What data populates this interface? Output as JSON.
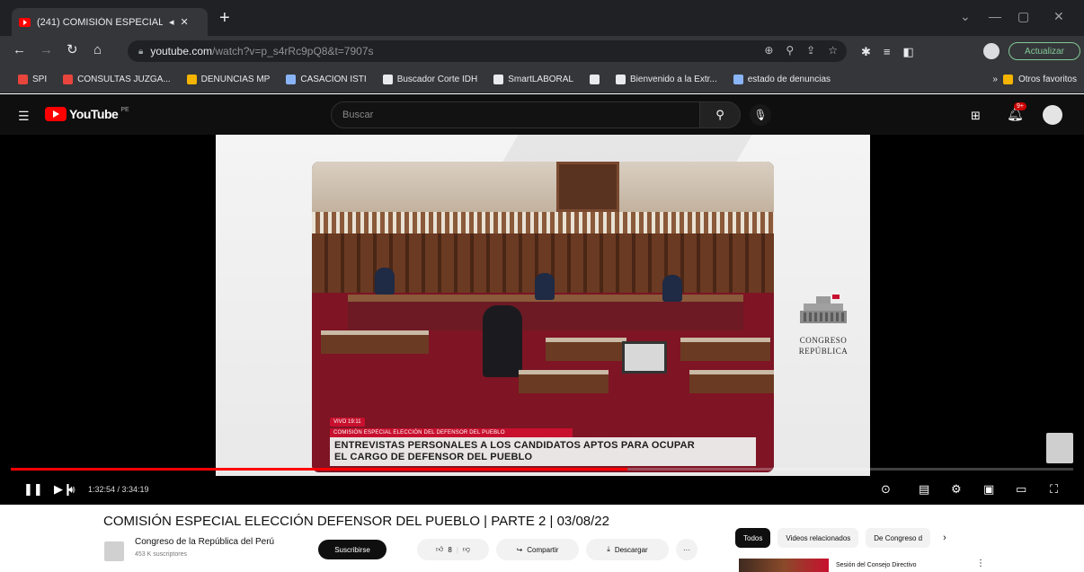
{
  "browser": {
    "tab": {
      "title": "(241) COMISIÓN ESPECIAL E",
      "pin_icon": "pin-icon",
      "close": "✕"
    },
    "new_tab": "+",
    "url": {
      "host": "youtube.com",
      "path": "/watch?v=p_s4rRc9pQ8&t=7907s"
    },
    "update_button": "Actualizar",
    "bookmarks": [
      {
        "label": "SPI",
        "color": "#e8453c"
      },
      {
        "label": "CONSULTAS JUZGA...",
        "color": "#e8453c"
      },
      {
        "label": "DENUNCIAS MP",
        "color": "#f4b400"
      },
      {
        "label": "CASACION ISTI",
        "color": "#8ab4f8"
      },
      {
        "label": "Buscador Corte IDH",
        "color": "#e8eaed"
      },
      {
        "label": "SmartLABORAL",
        "color": "#e8eaed"
      },
      {
        "label": "",
        "color": "#e8eaed"
      },
      {
        "label": "Bienvenido a la Extr...",
        "color": "#e8eaed"
      },
      {
        "label": "estado de denuncias",
        "color": "#8ab4f8"
      }
    ],
    "other_bookmarks": "Otros favoritos"
  },
  "youtube": {
    "logo_text": "YouTube",
    "logo_cc": "PE",
    "search_placeholder": "Buscar",
    "notifications_badge": "9+"
  },
  "player": {
    "progress_fraction": 0.58,
    "time_current": "1:32:54",
    "time_total": "3:34:19",
    "time_display": "1:32:54 / 3:34:19",
    "overlay": {
      "tag": "VIVO 19:11",
      "subtitle": "COMISIÓN ESPECIAL ELECCIÓN DEL DEFENSOR DEL PUEBLO",
      "headline_line1": "ENTREVISTAS PERSONALES A LOS CANDIDATOS APTOS PARA OCUPAR",
      "headline_line2": "EL CARGO DE DEFENSOR DEL PUEBLO"
    },
    "congreso_line1": "CONGRESO",
    "congreso_line2": "REPÚBLICA"
  },
  "video": {
    "title": "COMISIÓN ESPECIAL ELECCIÓN DEFENSOR DEL PUEBLO | PARTE 2 | 03/08/22",
    "channel": "Congreso de la República del Perú",
    "subscribers": "453 K suscriptores",
    "subscribe_label": "Suscribirse",
    "likes": "8",
    "share_label": "Compartir",
    "download_label": "Descargar",
    "more_label": "···"
  },
  "sidebar": {
    "chips": [
      "Todos",
      "Videos relacionados",
      "De Congreso d"
    ],
    "chip_next": "›",
    "related_title": "Sesión del Consejo Directivo",
    "related_more": "⋮"
  },
  "colors": {
    "youtube_red": "#ff0000",
    "overlay_red": "#c8102e",
    "chrome_dark": "#35363a"
  }
}
